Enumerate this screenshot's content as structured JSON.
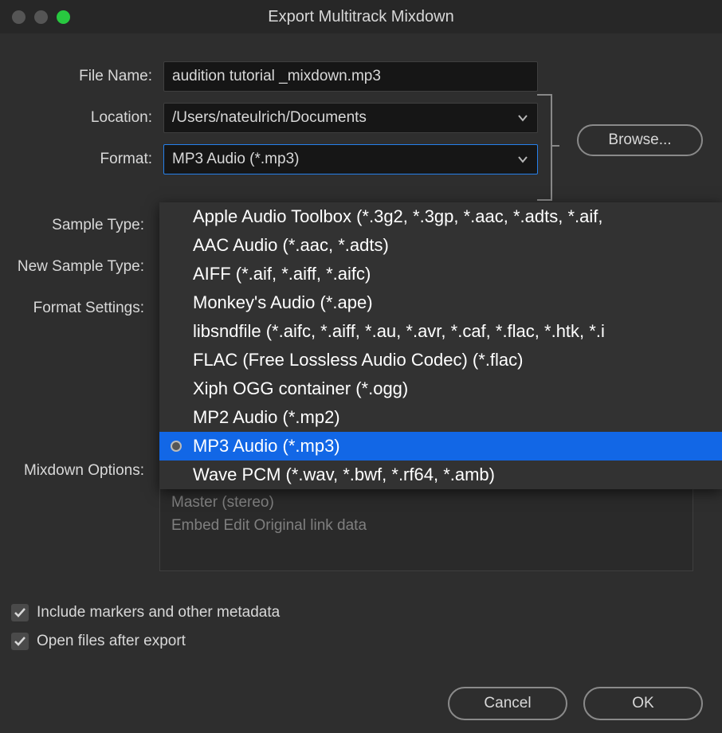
{
  "window": {
    "title": "Export Multitrack Mixdown"
  },
  "labels": {
    "file_name": "File Name:",
    "location": "Location:",
    "format": "Format:",
    "sample_type": "Sample Type:",
    "new_sample_type": "New Sample Type:",
    "format_settings": "Format Settings:",
    "mixdown_options": "Mixdown Options:"
  },
  "fields": {
    "file_name_value": "audition tutorial _mixdown.mp3",
    "location_value": "/Users/nateulrich/Documents",
    "format_value": "MP3 Audio (*.mp3)"
  },
  "browse_label": "Browse...",
  "mixdown_info": {
    "line1": "Master (stereo)",
    "line2": "Embed Edit Original link data"
  },
  "checkboxes": {
    "include_markers": "Include markers and other metadata",
    "open_files": "Open files after export"
  },
  "buttons": {
    "cancel": "Cancel",
    "ok": "OK"
  },
  "format_options": [
    "Apple Audio Toolbox (*.3g2, *.3gp, *.aac, *.adts, *.aif,",
    "AAC Audio (*.aac, *.adts)",
    "AIFF (*.aif, *.aiff, *.aifc)",
    "Monkey's Audio (*.ape)",
    "libsndfile (*.aifc, *.aiff, *.au, *.avr, *.caf, *.flac, *.htk, *.i",
    "FLAC (Free Lossless Audio Codec) (*.flac)",
    "Xiph OGG container (*.ogg)",
    "MP2 Audio (*.mp2)",
    "MP3 Audio (*.mp3)",
    "Wave PCM (*.wav, *.bwf, *.rf64, *.amb)"
  ],
  "format_selected_index": 8
}
